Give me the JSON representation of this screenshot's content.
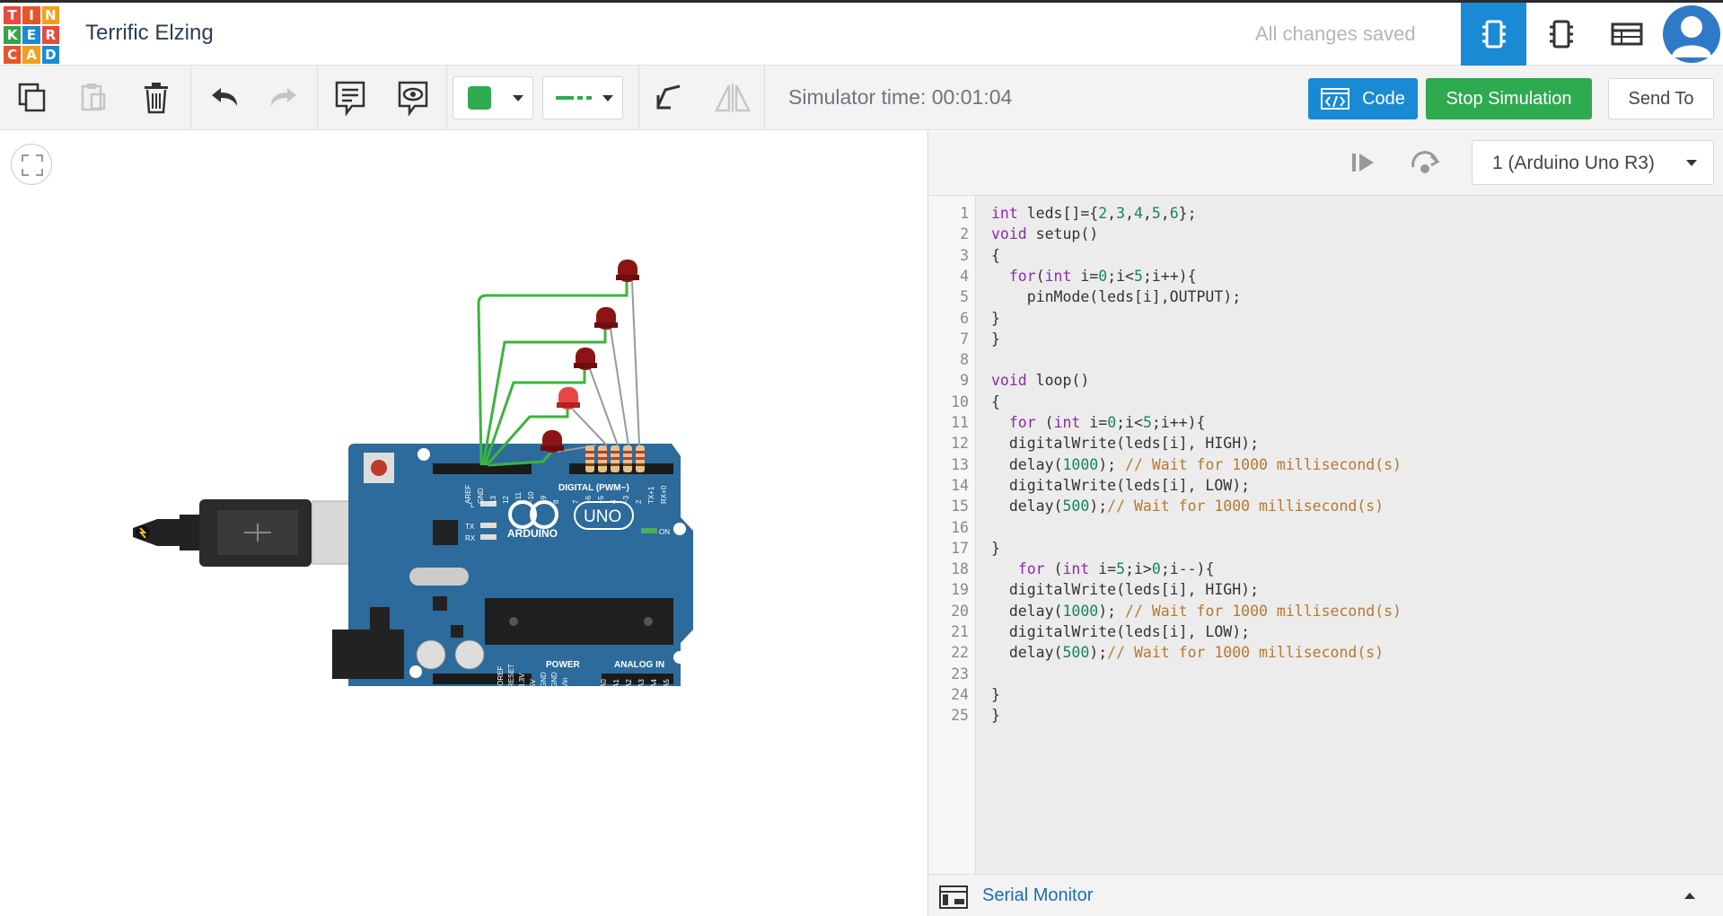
{
  "header": {
    "logo_letters": [
      "T",
      "I",
      "N",
      "K",
      "E",
      "R",
      "C",
      "A",
      "D"
    ],
    "logo_colors": [
      "#e74b3c",
      "#e8542a",
      "#f2a01b",
      "#3aa24a",
      "#1a8ad4",
      "#e64b3c",
      "#e8542a",
      "#f2a01b",
      "#1a8ad4"
    ],
    "title": "Terrific Elzing",
    "status": "All changes saved",
    "view_buttons": [
      "circuit-view-icon",
      "schematic-view-icon",
      "component-list-icon"
    ]
  },
  "toolbar": {
    "simulator_time": "Simulator time: 00:01:04",
    "code_label": "Code",
    "stop_label": "Stop Simulation",
    "send_label": "Send To",
    "wire_color": "#2eaa4f"
  },
  "code_panel": {
    "board": "1 (Arduino Uno R3)",
    "lines": [
      "int leds[]={2,3,4,5,6};",
      "void setup()",
      "{",
      "  for(int i=0;i<5;i++){",
      "    pinMode(leds[i],OUTPUT);",
      "}",
      "}",
      "",
      "void loop()",
      "{",
      "  for (int i=0;i<5;i++){",
      "  digitalWrite(leds[i], HIGH);",
      "  delay(1000); // Wait for 1000 millisecond(s)",
      "  digitalWrite(leds[i], LOW);",
      "  delay(500);// Wait for 1000 millisecond(s)",
      "",
      "}",
      "   for (int i=5;i>0;i--){",
      "  digitalWrite(leds[i], HIGH);",
      "  delay(1000); // Wait for 1000 millisecond(s)",
      "  digitalWrite(leds[i], LOW);",
      "  delay(500);// Wait for 1000 millisecond(s)",
      "",
      "}",
      "}"
    ],
    "serial_monitor": "Serial Monitor"
  },
  "board": {
    "name": "UNO",
    "brand": "ARDUINO",
    "digital_label": "DIGITAL (PWM~)",
    "power_label": "POWER",
    "analog_label": "ANALOG IN",
    "on_label": "ON",
    "l_label": "L",
    "tx_label": "TX",
    "rx_label": "RX",
    "pin_top": [
      "AREF",
      "GND",
      "13",
      "12",
      "~11",
      "~10",
      "~9",
      "8",
      "7",
      "~6",
      "~5",
      "4",
      "~3",
      "2",
      "TX+1",
      "RX+0"
    ],
    "pin_power": [
      "IOREF",
      "RESET",
      "3.3V",
      "5V",
      "GND",
      "GND",
      "Vin"
    ],
    "pin_analog": [
      "A0",
      "A1",
      "A2",
      "A3",
      "A4",
      "A5"
    ]
  }
}
